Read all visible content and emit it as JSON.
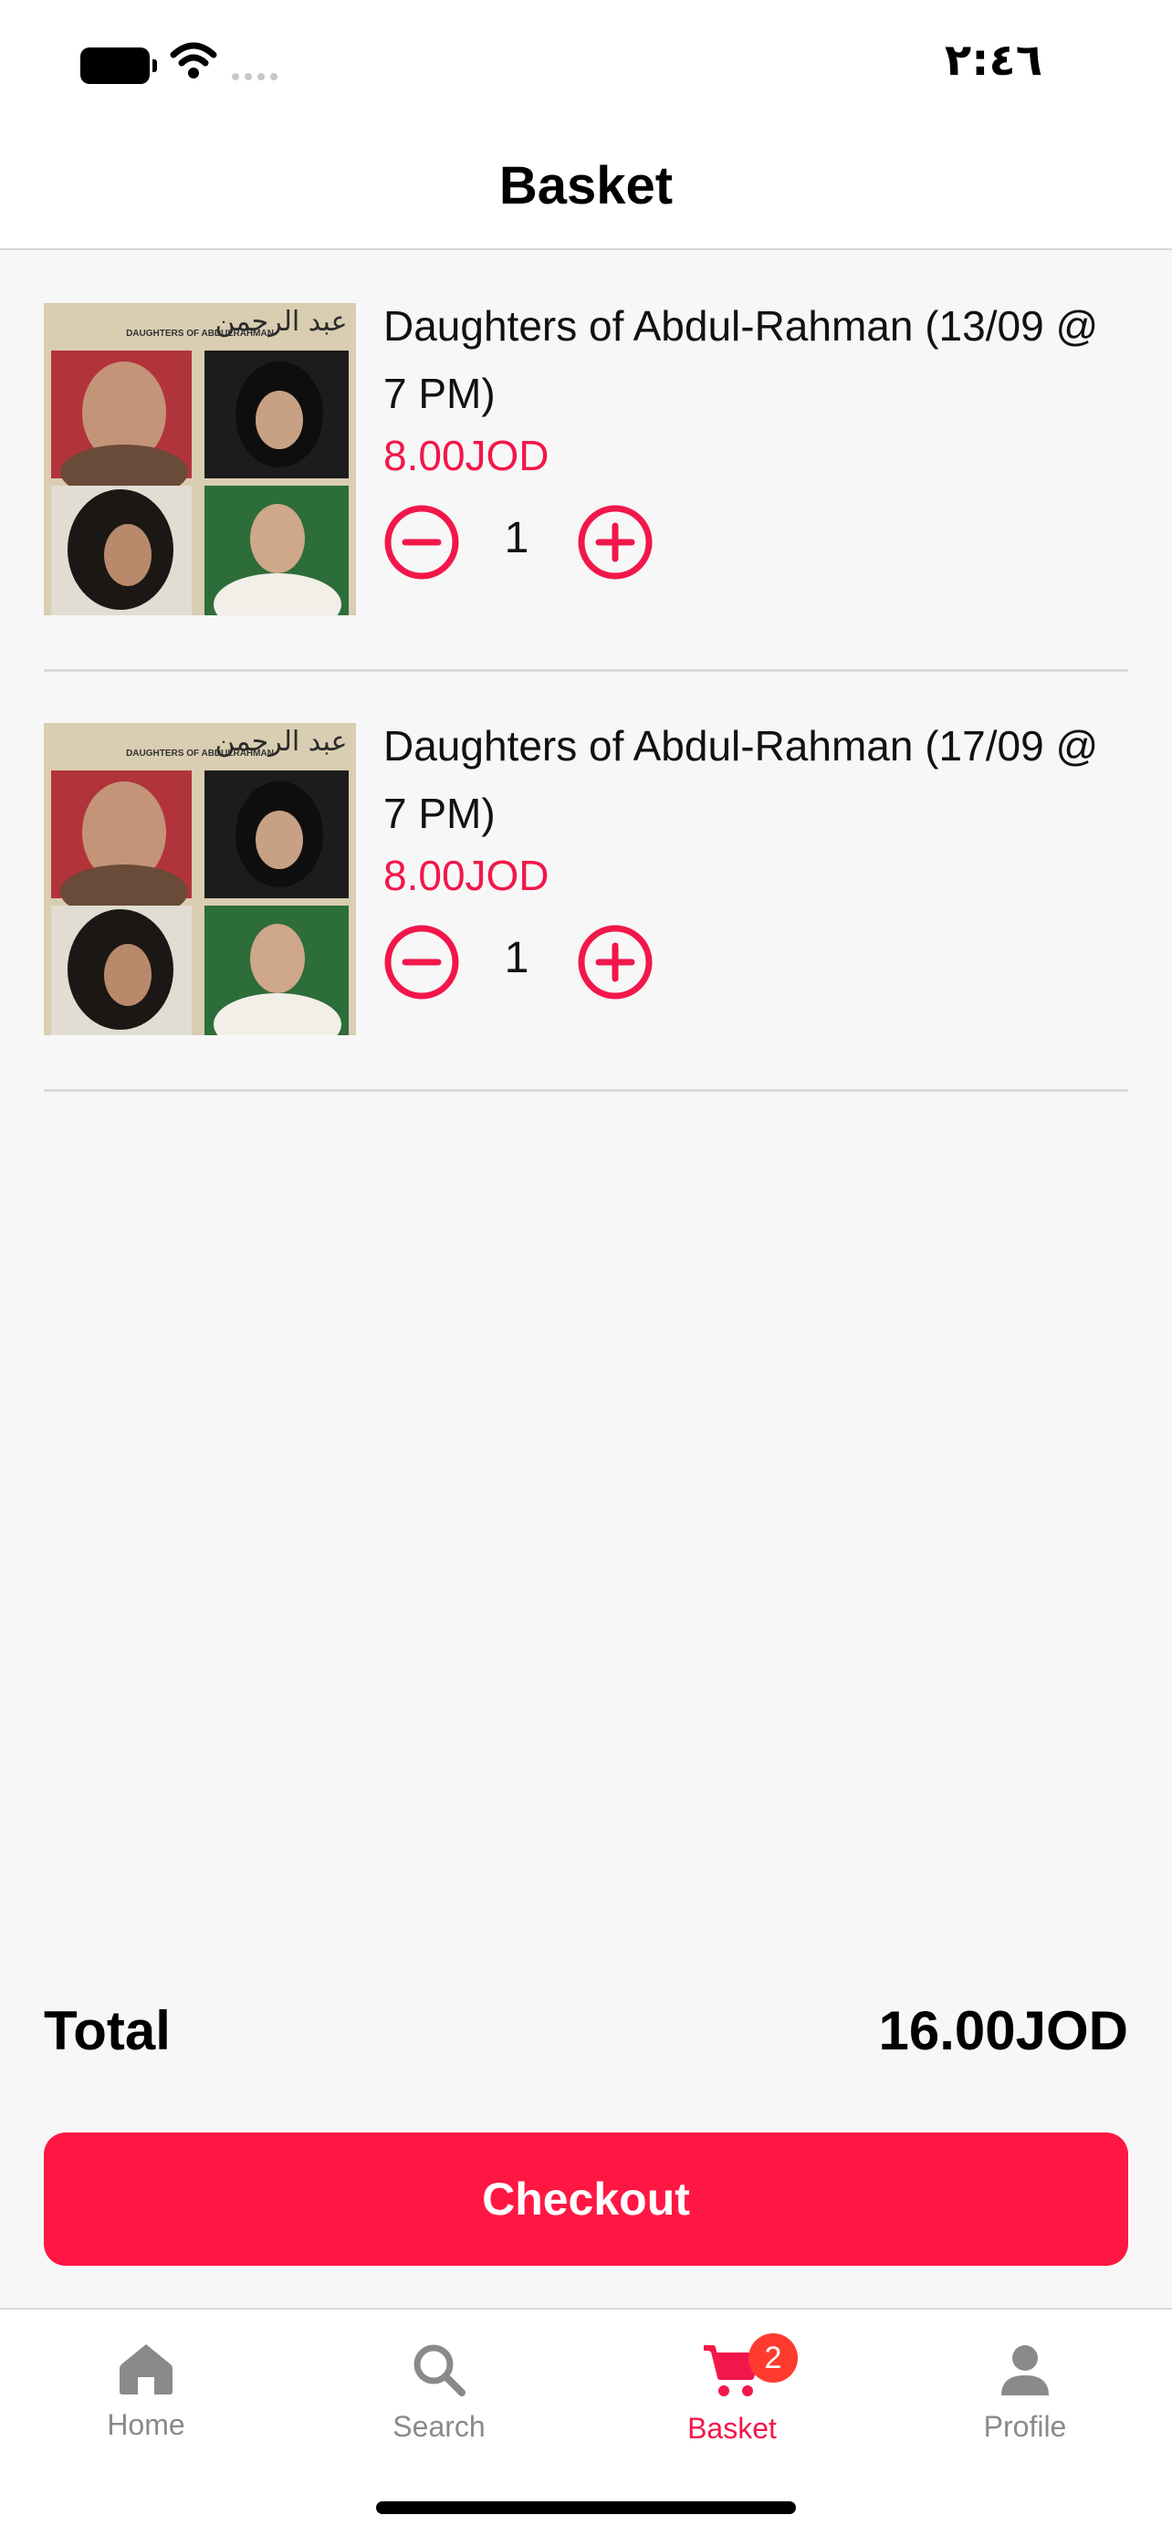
{
  "status_bar": {
    "time": "٢:٤٦"
  },
  "header": {
    "title": "Basket"
  },
  "basket": {
    "items": [
      {
        "title": "Daughters of Abdul-Rahman (13/09 @ 7 PM)",
        "price": "8.00JOD",
        "quantity": "1"
      },
      {
        "title": "Daughters of Abdul-Rahman (17/09 @ 7 PM)",
        "price": "8.00JOD",
        "quantity": "1"
      }
    ],
    "poster_text": {
      "arabic": "عبد الرحمن",
      "english": "DAUGHTERS OF ABDULRAHMAN"
    }
  },
  "summary": {
    "total_label": "Total",
    "total_value": "16.00JOD",
    "checkout_label": "Checkout"
  },
  "tab_bar": {
    "tabs": [
      {
        "label": "Home",
        "icon": "home-icon"
      },
      {
        "label": "Search",
        "icon": "search-icon"
      },
      {
        "label": "Basket",
        "icon": "cart-icon",
        "badge": "2",
        "active": true
      },
      {
        "label": "Profile",
        "icon": "person-icon"
      }
    ]
  },
  "colors": {
    "accent": "#ff1744",
    "price": "#f2174a",
    "badge": "#ff3b30",
    "inactive": "#8a8a8a"
  }
}
